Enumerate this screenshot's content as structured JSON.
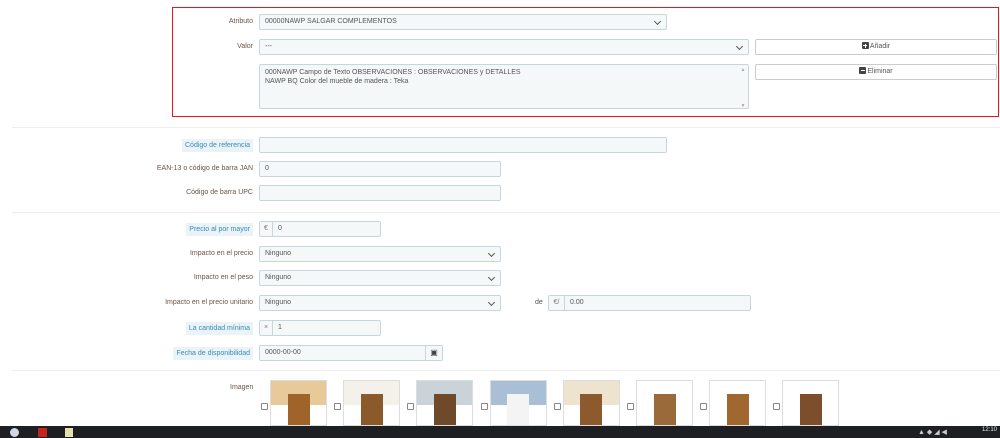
{
  "attribute_section": {
    "atributo_label": "Atributo",
    "atributo_value": "00000NAWP SALGAR COMPLEMENTOS",
    "valor_label": "Valor",
    "valor_value": "---",
    "add_button": "Añadir",
    "delete_button": "Eliminar",
    "combination_lines": [
      "000NAWP Campo de Texto OBSERVACIONES : OBSERVACIONES y DETALLES",
      "NAWP BQ Color del mueble de madera : Teka"
    ],
    "highlight_color": "#e8151b"
  },
  "codes": {
    "reference_label": "Código de referencia",
    "reference_value": "",
    "ean_label": "EAN-13 o código de barra JAN",
    "ean_value": "0",
    "upc_label": "Código de barra UPC",
    "upc_value": ""
  },
  "pricing": {
    "wholesale_label": "Precio al por mayor",
    "currency": "€",
    "wholesale_value": "0",
    "price_impact_label": "Impacto en el precio",
    "price_impact_value": "Ninguno",
    "weight_impact_label": "Impacto en el peso",
    "weight_impact_value": "Ninguno",
    "unit_impact_label": "Impacto en el precio unitario",
    "unit_impact_value": "Ninguno",
    "de_label": "de",
    "unit_currency": "€/",
    "unit_value": "0.00",
    "min_qty_label": "La cantidad mínima",
    "min_qty_prefix": "×",
    "min_qty_value": "1",
    "availability_label": "Fecha de disponibilidad",
    "availability_value": "0000-00-00"
  },
  "images": {
    "label": "Imagen",
    "count": 8
  },
  "taskbar": {
    "clock": "12:10"
  }
}
